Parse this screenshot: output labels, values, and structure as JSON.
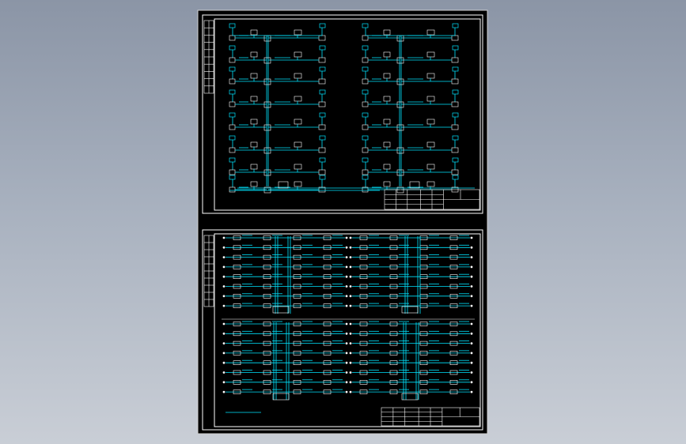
{
  "document": {
    "type": "electrical-system-diagram",
    "sheets": [
      {
        "id": "upper",
        "layout": "distribution-riser",
        "title_block_label": ""
      },
      {
        "id": "lower",
        "layout": "circuit-schedule",
        "title_block_label": ""
      }
    ]
  },
  "colors": {
    "background": "#8b95a6",
    "sheet": "#000000",
    "frame": "#ffffff",
    "wiring": "#00e5ff",
    "symbols": "#ffffff"
  }
}
